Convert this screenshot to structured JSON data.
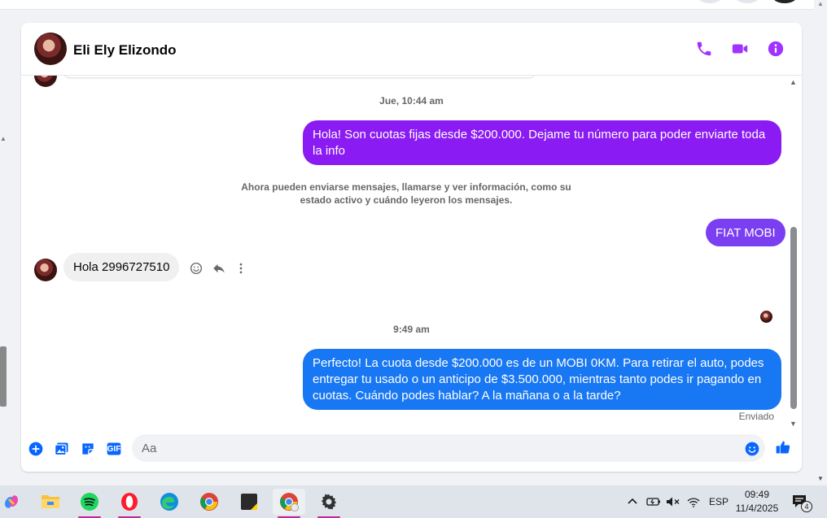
{
  "header": {
    "contact_name": "Eli Ely Elizondo"
  },
  "messages": {
    "timestamp_1": "Jue, 10:44 am",
    "outgoing_1": "Hola! Son cuotas fijas desde $200.000. Dejame tu número para poder enviarte toda la info",
    "system_note": "Ahora pueden enviarse mensajes, llamarse y ver información, como su estado activo y cuándo leyeron los mensajes.",
    "outgoing_2": "FIAT MOBI",
    "incoming_1": "Hola  2996727510",
    "timestamp_2": "9:49 am",
    "outgoing_3": "Perfecto! La cuota desde $200.000 es de un MOBI 0KM. Para retirar el auto, podes entregar tu usado o un anticipo de $3.500.000, mientras tanto podes ir pagando en cuotas. Cuándo podes hablar? A la mañana o a la tarde?",
    "status": "Enviado"
  },
  "composer": {
    "placeholder": "Aa",
    "gif_label": "GIF"
  },
  "taskbar": {
    "apps": [
      "copilot-icon",
      "file-explorer-icon",
      "spotify-icon",
      "opera-icon",
      "edge-icon",
      "chrome-icon",
      "sticky-notes-icon",
      "chrome-profile-icon",
      "settings-icon"
    ],
    "language": "ESP",
    "time": "09:49",
    "date": "11/4/2025",
    "notification_count": "4"
  },
  "colors": {
    "accent_purple": "#8a1bf2",
    "bubble_violet": "#7b3ff2",
    "bubble_blue": "#1877f2",
    "icon_purple": "#a033ff",
    "composer_blue": "#0866ff"
  }
}
